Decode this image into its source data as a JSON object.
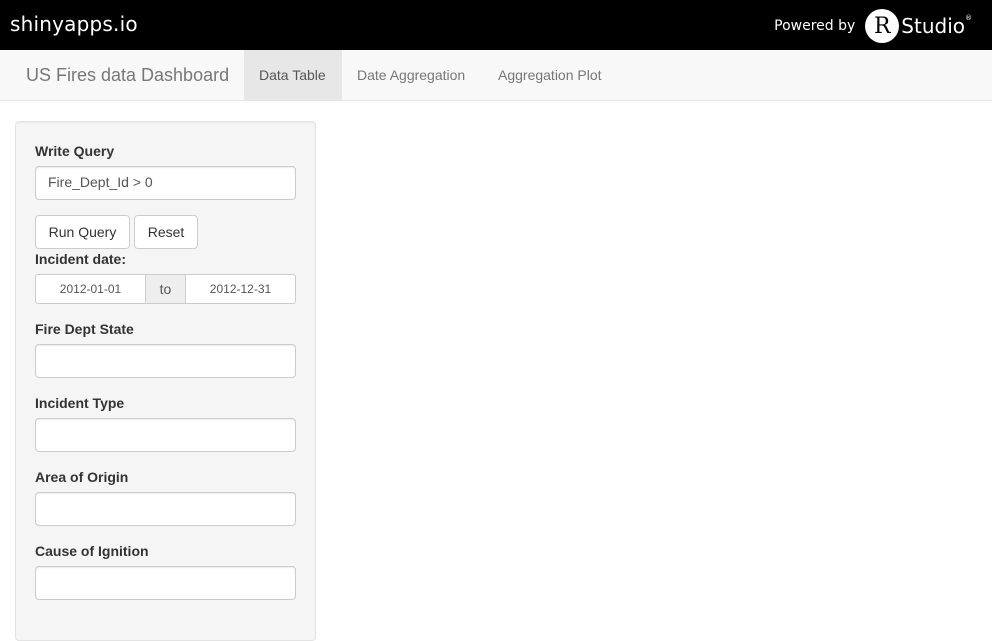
{
  "topbar": {
    "brand": "shinyapps.io",
    "powered_by": "Powered by",
    "rstudio_r": "R",
    "rstudio_studio": "Studio",
    "rstudio_reg": "®"
  },
  "navbar": {
    "title": "US Fires data Dashboard",
    "tabs": [
      {
        "label": "Data Table",
        "active": true
      },
      {
        "label": "Date Aggregation",
        "active": false
      },
      {
        "label": "Aggregation Plot",
        "active": false
      }
    ]
  },
  "sidebar": {
    "query_label": "Write Query",
    "query_value": "Fire_Dept_Id > 0",
    "run_button": "Run Query",
    "reset_button": "Reset",
    "date_label": "Incident date:",
    "date_start": "2012-01-01",
    "date_separator": "to",
    "date_end": "2012-12-31",
    "state_label": "Fire Dept State",
    "state_value": "",
    "incident_type_label": "Incident Type",
    "incident_type_value": "",
    "area_label": "Area of Origin",
    "area_value": "",
    "cause_label": "Cause of Ignition",
    "cause_value": ""
  }
}
